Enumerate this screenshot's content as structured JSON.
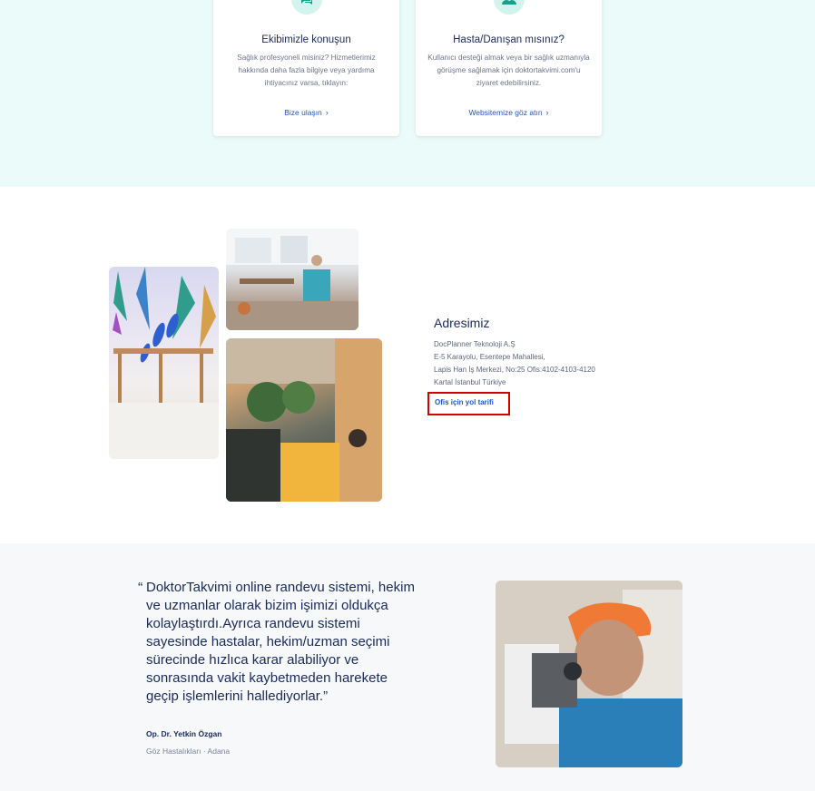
{
  "contact": {
    "cards": [
      {
        "icon": "chat-icon",
        "title": "Ekibimizle konuşun",
        "text": "Sağlık profesyoneli misiniz? Hizmetlerimiz hakkında daha fazla bilgiye veya yardıma ihtiyacınız varsa, tıklayın:",
        "link": "Bize ulaşın",
        "chevron": "›"
      },
      {
        "icon": "users-icon",
        "title": "Hasta/Danışan mısınız?",
        "text": "Kullanıcı desteği almak veya bir sağlık uzmanıyla görüşme sağlamak için doktortakvimi.com'u ziyaret edebilirsiniz.",
        "link": "Websitemize göz atın",
        "chevron": "›"
      }
    ]
  },
  "address": {
    "title": "Adresimiz",
    "lines": [
      "DocPlanner Teknoloji A.Ş",
      "E-5 Karayolu, Esentepe Mahallesi,",
      "Lapis Han İş Merkezi, No:25 Ofis:4102-4103-4120",
      "Kartal İstanbul Türkiye"
    ],
    "directions_link": "Ofis için yol tarifi"
  },
  "testimonial": {
    "open_quote": "“",
    "quote": "DoktorTakvimi online randevu sistemi, hekim ve uzmanlar olarak bizim işimizi oldukça kolaylaştırdı.Ayrıca randevu sistemi sayesinde hastalar, hekim/uzman seçimi sürecinde hızlıca karar alabiliyor ve sonrasında vakit kaybetmeden harekete geçip işlemlerini hallediyorlar.”",
    "author": "Op. Dr. Yetkin Özgan",
    "meta": "Göz Hastalıkları · Adana"
  },
  "colors": {
    "mint_bg": "#eafbf9",
    "brand_navy": "#1b2a5c",
    "link_blue": "#1f57c3",
    "highlight_red": "#d30000"
  }
}
